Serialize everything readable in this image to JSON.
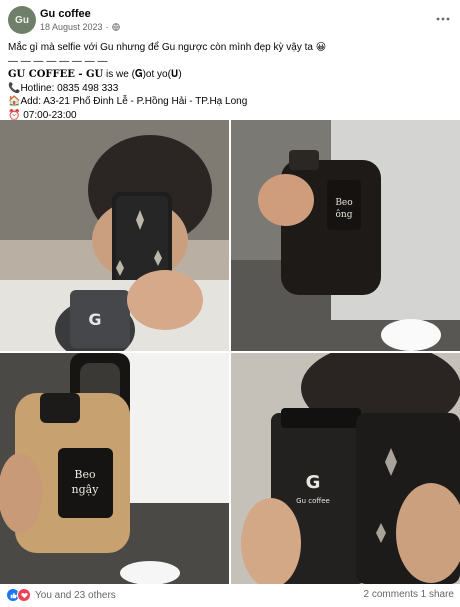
{
  "post": {
    "author": "Gu coffee",
    "date": "18 August 2023",
    "avatar_initial": "Gu",
    "caption": {
      "line1": "Mắc gì mà selfie với Gu nhưng để Gu ngược còn mình đẹp kỳ vậy ta",
      "line1_emoji": "😀",
      "divider": "— — — — — — — —",
      "brand": "𝐆𝐔 𝐂𝐎𝐅𝐅𝐄𝐄 - 𝐆𝐔",
      "brand_tail": " is we (𝐆)ot yo(𝐔)",
      "hotline": "📞Hotline: 0835 498 333",
      "address": "🏠Add: A3-21 Phố Đinh Lễ - P.Hồng Hải - TP.Hạ Long",
      "hours": "⏰ 07:00-23:00"
    },
    "photos": [
      {
        "label": "mirror selfie with phone and Gu coffee cup"
      },
      {
        "label": "hand holding Gu bottle"
      },
      {
        "label": "hand holding Beo bottle"
      },
      {
        "label": "phone covering face with Gu coffee cup"
      }
    ],
    "footer": {
      "reactions_text": "You and 23 others",
      "comments": "2 comments",
      "shares": "1 share"
    }
  },
  "icons": {
    "globe": "globe-icon",
    "more": "more-icon",
    "like": "like-icon",
    "love": "love-icon"
  },
  "colors": {
    "link_blue": "#1877f2",
    "love_red": "#f33e58",
    "secondary_text": "#65676b"
  }
}
